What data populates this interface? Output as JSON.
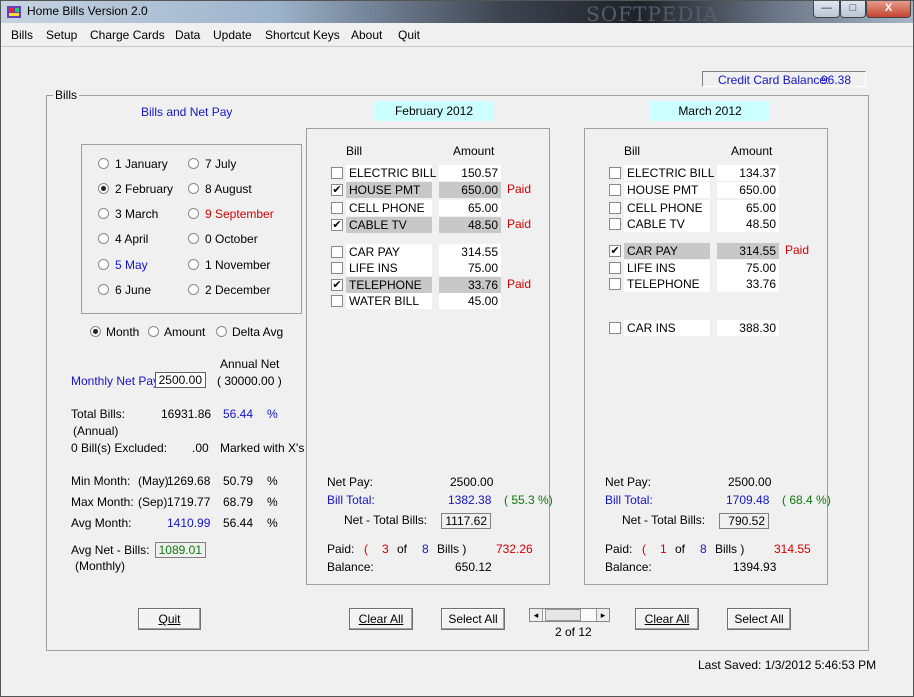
{
  "window": {
    "title": "Home Bills  Version 2.0",
    "watermark": "SOFTPEDIA",
    "min_glyph": "—",
    "max_glyph": "□",
    "close_glyph": "X"
  },
  "menu": [
    "Bills",
    "Setup",
    "Charge Cards",
    "Data",
    "Update",
    "Shortcut Keys",
    "About",
    "Quit"
  ],
  "credit": {
    "label": "Credit Card Balance:",
    "value": "96.38"
  },
  "group_label": "Bills",
  "left": {
    "heading": "Bills and Net Pay",
    "months": [
      {
        "label": "1 January",
        "selected": false,
        "color": "black"
      },
      {
        "label": "2 February",
        "selected": true,
        "color": "black"
      },
      {
        "label": "3 March",
        "selected": false,
        "color": "black"
      },
      {
        "label": "4 April",
        "selected": false,
        "color": "black"
      },
      {
        "label": "5 May",
        "selected": false,
        "color": "blue"
      },
      {
        "label": "6 June",
        "selected": false,
        "color": "black"
      },
      {
        "label": "7 July",
        "selected": false,
        "color": "black"
      },
      {
        "label": "8 August",
        "selected": false,
        "color": "black"
      },
      {
        "label": "9 September",
        "selected": false,
        "color": "red"
      },
      {
        "label": "0 October",
        "selected": false,
        "color": "black"
      },
      {
        "label": "1 November",
        "selected": false,
        "color": "black"
      },
      {
        "label": "2 December",
        "selected": false,
        "color": "black"
      }
    ],
    "sort": [
      {
        "label": "Month",
        "selected": true
      },
      {
        "label": "Amount",
        "selected": false
      },
      {
        "label": "Delta Avg",
        "selected": false
      }
    ],
    "annual_net_label": "Annual Net",
    "monthly_net_label": "Monthly Net Pay:",
    "monthly_net_value": "2500.00",
    "annual_net_value": "( 30000.00  )",
    "total_bills_label": "Total Bills:",
    "total_bills_value": "16931.86",
    "total_bills_pct": "56.44",
    "pct_sign": "%",
    "annual_label": "(Annual)",
    "excluded_label": "0 Bill(s) Excluded:",
    "excluded_value": ".00",
    "excluded_note": "Marked with X's",
    "min_label": "Min Month:",
    "min_month": "(May)",
    "min_value": "1269.68",
    "min_pct": "50.79",
    "max_label": "Max Month:",
    "max_month": "(Sep)",
    "max_value": "1719.77",
    "max_pct": "68.79",
    "avg_label": "Avg Month:",
    "avg_value": "1410.99",
    "avg_pct": "56.44",
    "avgnet_label": "Avg Net - Bills:",
    "avgnet_sub": "(Monthly)",
    "avgnet_value": "1089.01"
  },
  "panels": [
    {
      "month": "February 2012",
      "bill_header": "Bill",
      "amount_header": "Amount",
      "bills": [
        {
          "name": "ELECTRIC BILL",
          "amount": "150.57",
          "checked": false,
          "paid": ""
        },
        {
          "name": "HOUSE PMT",
          "amount": "650.00",
          "checked": true,
          "paid": "Paid"
        },
        {
          "name": "CELL PHONE",
          "amount": "65.00",
          "checked": false,
          "paid": ""
        },
        {
          "name": "CABLE TV",
          "amount": "48.50",
          "checked": true,
          "paid": "Paid"
        },
        {
          "name": "CAR PAY",
          "amount": "314.55",
          "checked": false,
          "paid": ""
        },
        {
          "name": "LIFE INS",
          "amount": "75.00",
          "checked": false,
          "paid": ""
        },
        {
          "name": "TELEPHONE",
          "amount": "33.76",
          "checked": true,
          "paid": "Paid"
        },
        {
          "name": "WATER BILL",
          "amount": "45.00",
          "checked": false,
          "paid": ""
        }
      ],
      "net_pay_label": "Net Pay:",
      "net_pay": "2500.00",
      "bill_total_label": "Bill Total:",
      "bill_total": "1382.38",
      "bill_pct": "( 55.3 %)",
      "net_minus_label": "Net - Total Bills:",
      "net_minus": "1117.62",
      "paid_label": "Paid:",
      "paid_count": "3",
      "of_label": "of",
      "bill_count": "8",
      "bills_word": "Bills )",
      "open_paren": "(",
      "paid_amount": "732.26",
      "balance_label": "Balance:",
      "balance": "650.12",
      "clear_label": "Clear All",
      "select_label": "Select All"
    },
    {
      "month": "March 2012",
      "bill_header": "Bill",
      "amount_header": "Amount",
      "bills": [
        {
          "name": "ELECTRIC BILL",
          "amount": "134.37",
          "checked": false,
          "paid": ""
        },
        {
          "name": "HOUSE PMT",
          "amount": "650.00",
          "checked": false,
          "paid": ""
        },
        {
          "name": "CELL PHONE",
          "amount": "65.00",
          "checked": false,
          "paid": ""
        },
        {
          "name": "CABLE TV",
          "amount": "48.50",
          "checked": false,
          "paid": ""
        },
        {
          "name": "CAR PAY",
          "amount": "314.55",
          "checked": true,
          "paid": "Paid"
        },
        {
          "name": "LIFE INS",
          "amount": "75.00",
          "checked": false,
          "paid": ""
        },
        {
          "name": "TELEPHONE",
          "amount": "33.76",
          "checked": false,
          "paid": ""
        },
        {
          "name": "CAR INS",
          "amount": "388.30",
          "checked": false,
          "paid": ""
        }
      ],
      "net_pay_label": "Net Pay:",
      "net_pay": "2500.00",
      "bill_total_label": "Bill Total:",
      "bill_total": "1709.48",
      "bill_pct": "( 68.4 %)",
      "net_minus_label": "Net - Total Bills:",
      "net_minus": "790.52",
      "paid_label": "Paid:",
      "paid_count": "1",
      "of_label": "of",
      "bill_count": "8",
      "bills_word": "Bills )",
      "open_paren": "(",
      "paid_amount": "314.55",
      "balance_label": "Balance:",
      "balance": "1394.93",
      "clear_label": "Clear All",
      "select_label": "Select All"
    }
  ],
  "quit_label": "Quit",
  "scroller": {
    "left_glyph": "◂",
    "right_glyph": "▸",
    "label": "2 of 12",
    "position": 0.09
  },
  "last_saved": "Last Saved:  1/3/2012 5:46:53 PM",
  "colors": {
    "month_header": "#ccffff",
    "highlight": "#c8c8c8",
    "blue_text": "#1515c8",
    "red_text": "#d40000",
    "green_text": "#0a7a0a"
  }
}
